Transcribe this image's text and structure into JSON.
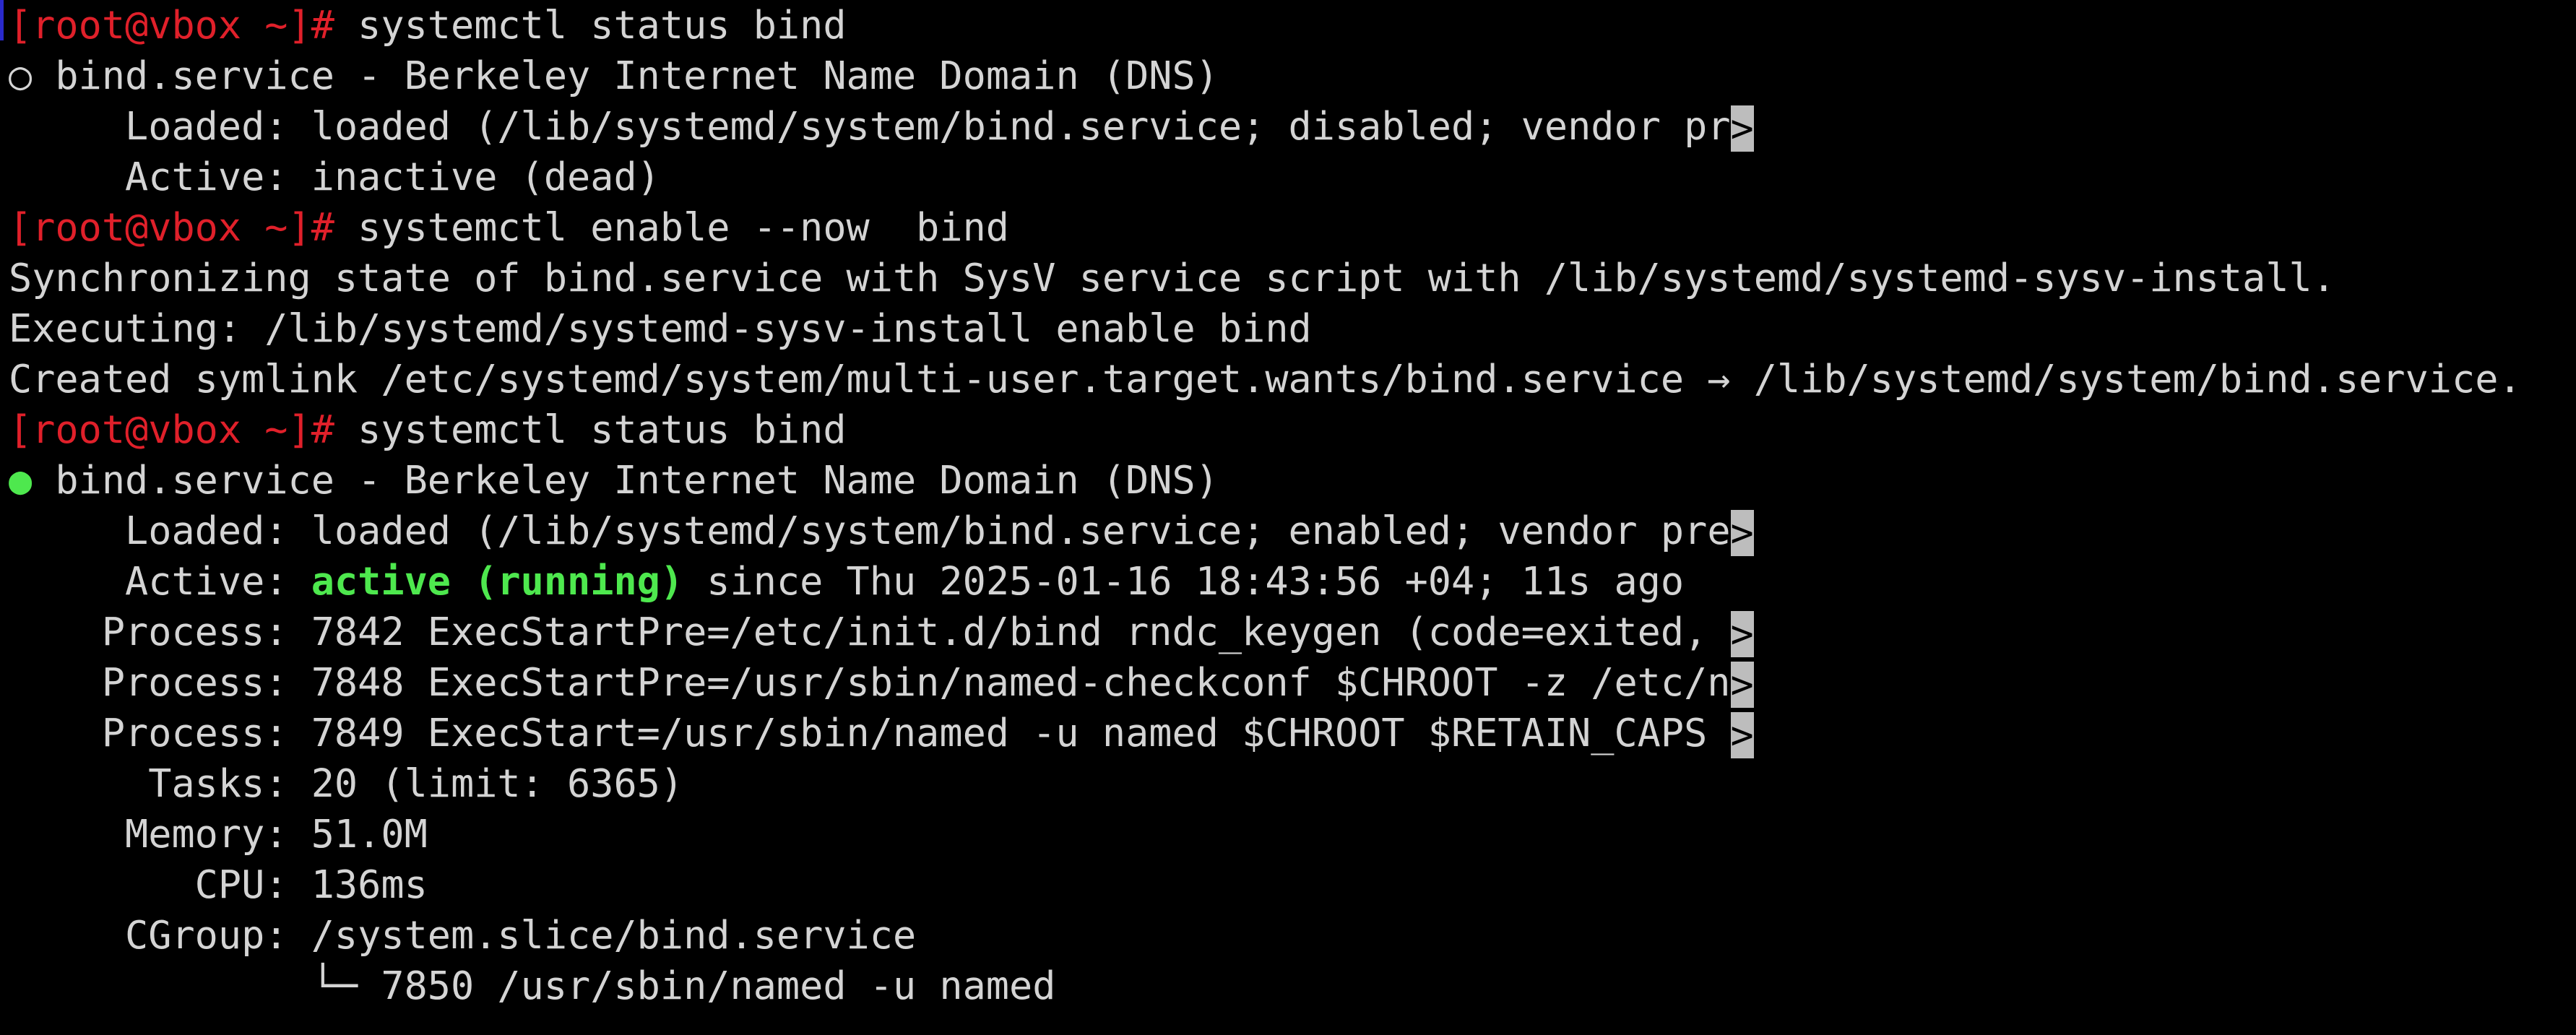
{
  "colors": {
    "background": "#000000",
    "text": "#d4d4d4",
    "prompt": "#e0202a",
    "active": "#4ee84e",
    "truncation_marker": "#bdbdbd"
  },
  "terminal": {
    "prompt": "[root@vbox ~]#",
    "truncation_glyph": ">",
    "block1": {
      "command": " systemctl status bind",
      "status_dot": "○",
      "service_line": " bind.service - Berkeley Internet Name Domain (DNS)",
      "loaded_label": "     Loaded:",
      "loaded_value": " loaded (/lib/systemd/system/bind.service; disabled; vendor pr",
      "active_label": "     Active:",
      "active_value": " inactive (dead)"
    },
    "block2": {
      "command": " systemctl enable --now  bind",
      "output": [
        "Synchronizing state of bind.service with SysV service script with /lib/systemd/systemd-sysv-install.",
        "Executing: /lib/systemd/systemd-sysv-install enable bind",
        "Created symlink /etc/systemd/system/multi-user.target.wants/bind.service → /lib/systemd/system/bind.service."
      ]
    },
    "block3": {
      "command": " systemctl status bind",
      "status_dot": "●",
      "service_line": " bind.service - Berkeley Internet Name Domain (DNS)",
      "loaded_label": "     Loaded:",
      "loaded_value": " loaded (/lib/systemd/system/bind.service; enabled; vendor pre",
      "active_label": "     Active: ",
      "active_state": "active (running)",
      "active_since": " since Thu 2025-01-16 18:43:56 +04; 11s ago",
      "process1": "    Process: 7842 ExecStartPre=/etc/init.d/bind rndc_keygen (code=exited, ",
      "process2": "    Process: 7848 ExecStartPre=/usr/sbin/named-checkconf $CHROOT -z /etc/n",
      "process3": "    Process: 7849 ExecStart=/usr/sbin/named -u named $CHROOT $RETAIN_CAPS ",
      "tasks": "      Tasks: 20 (limit: 6365)",
      "memory": "     Memory: 51.0M",
      "cpu": "        CPU: 136ms",
      "cgroup": "     CGroup: /system.slice/bind.service",
      "cgroup_child": "             └─ 7850 /usr/sbin/named -u named"
    }
  }
}
